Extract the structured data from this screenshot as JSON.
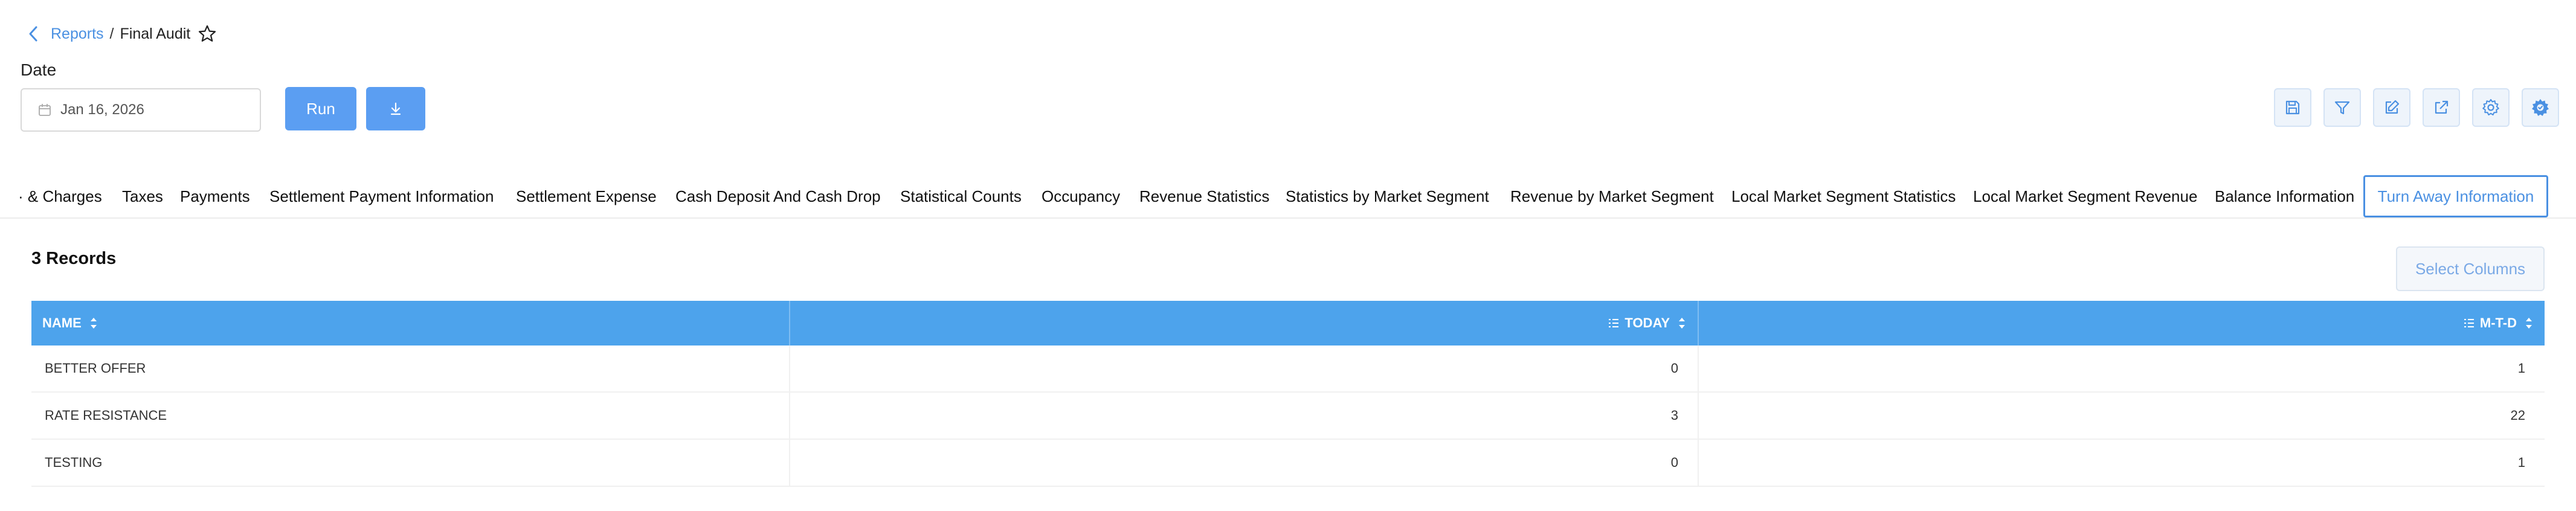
{
  "breadcrumb": {
    "parent": "Reports",
    "separator": "/",
    "current": "Final Audit"
  },
  "filters": {
    "date_label": "Date",
    "date_value": "Jan 16, 2026"
  },
  "actions": {
    "run_label": "Run"
  },
  "toolbar_icons": [
    "save-icon",
    "filter-icon",
    "edit-icon",
    "external-link-icon",
    "settings-icon",
    "gear-badge-icon"
  ],
  "tabs": [
    {
      "label": "· & Charges"
    },
    {
      "label": "Taxes"
    },
    {
      "label": "Payments"
    },
    {
      "label": "Settlement Payment Information"
    },
    {
      "label": "Settlement Expense"
    },
    {
      "label": "Cash Deposit And Cash Drop"
    },
    {
      "label": "Statistical Counts"
    },
    {
      "label": "Occupancy"
    },
    {
      "label": "Revenue Statistics"
    },
    {
      "label": "Statistics by Market Segment"
    },
    {
      "label": "Revenue by Market Segment"
    },
    {
      "label": "Local Market Segment Statistics"
    },
    {
      "label": "Local Market Segment Revenue"
    },
    {
      "label": "Balance Information"
    },
    {
      "label": "Turn Away Information",
      "active": true
    }
  ],
  "records_label": "3 Records",
  "select_columns_label": "Select Columns",
  "table": {
    "columns": [
      "NAME",
      "TODAY",
      "M-T-D"
    ],
    "rows": [
      [
        "BETTER OFFER",
        "0",
        "1"
      ],
      [
        "RATE RESISTANCE",
        "3",
        "22"
      ],
      [
        "TESTING",
        "0",
        "1"
      ]
    ]
  },
  "colors": {
    "accent": "#4a90e2",
    "header_bg": "#4da3ec",
    "button_bg": "#5b9ef2"
  }
}
